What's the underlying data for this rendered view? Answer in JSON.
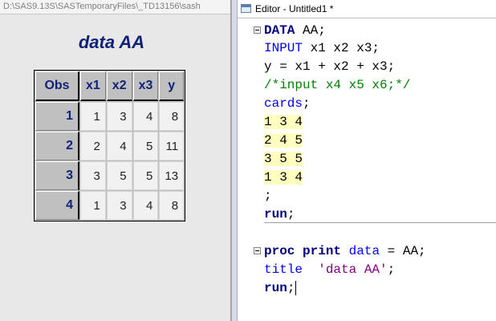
{
  "results_window": {
    "title": "D:\\SAS9.13S\\SASTemporaryFiles\\_TD13156\\sash",
    "report_title": "data AA",
    "columns": [
      "Obs",
      "x1",
      "x2",
      "x3",
      "y"
    ],
    "rows": [
      {
        "obs": "1",
        "x1": "1",
        "x2": "3",
        "x3": "4",
        "y": "8"
      },
      {
        "obs": "2",
        "x1": "2",
        "x2": "4",
        "x3": "5",
        "y": "11"
      },
      {
        "obs": "3",
        "x1": "3",
        "x2": "5",
        "x3": "5",
        "y": "13"
      },
      {
        "obs": "4",
        "x1": "1",
        "x2": "3",
        "x3": "4",
        "y": "8"
      }
    ]
  },
  "editor": {
    "title": "Editor - Untitled1 *",
    "data_step": {
      "kw_data": "DATA",
      "dataset": " AA;",
      "kw_input": "INPUT",
      "input_vars": " x1 x2 x3;",
      "assign": "y = x1 + x2 + x3;",
      "comment": "/*input x4 x5 x6;*/",
      "kw_cards": "cards",
      "cards_semi": ";",
      "datalines": [
        "1 3 4",
        "2 4 5",
        "3 5 5",
        "1 3 4"
      ],
      "terminator": ";",
      "kw_run": "run",
      "run_semi": ";"
    },
    "proc_step": {
      "kw_proc": "proc",
      "kw_print": "print",
      "kw_data_opt": "data",
      "data_opt_rest": " = AA;",
      "kw_title": "title",
      "title_string": "'data AA'",
      "title_semi": ";",
      "kw_run": "run",
      "run_semi": ";"
    }
  },
  "colors": {
    "keyword_blue": "#0000ff",
    "step_keyword": "#000080",
    "comment_green": "#008000",
    "string_purple": "#800080",
    "datalines_bg": "#ffffc0",
    "table_header": "#112277"
  }
}
